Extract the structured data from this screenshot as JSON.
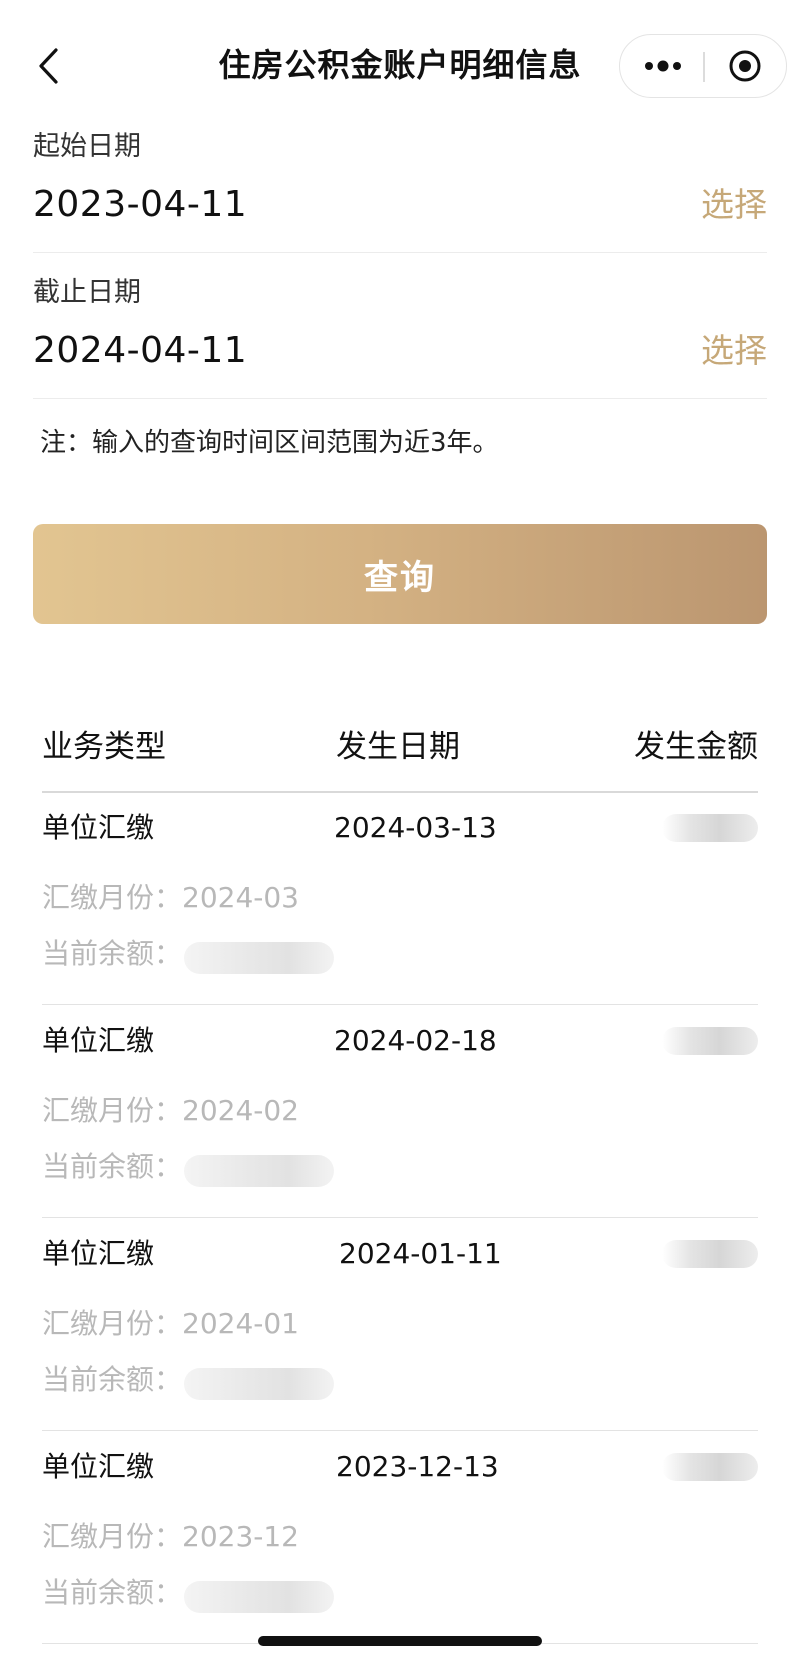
{
  "header": {
    "title": "住房公积金账户明细信息",
    "back_icon": "chevron-left-icon",
    "more_icon": "more-dots-icon",
    "close_icon": "target-circle-icon"
  },
  "start_date": {
    "label": "起始日期",
    "value": "2023-04-11",
    "select_label": "选择"
  },
  "end_date": {
    "label": "截止日期",
    "value": "2024-04-11",
    "select_label": "选择"
  },
  "note": "注：输入的查询时间区间范围为近3年。",
  "query_button": {
    "label": "查询"
  },
  "table": {
    "columns": [
      "业务类型",
      "发生日期",
      "发生金额"
    ],
    "records": [
      {
        "type": "单位汇缴",
        "date": "2024-03-13",
        "month": "汇缴月份：2024-03",
        "balance_label": "当前余额："
      },
      {
        "type": "单位汇缴",
        "date": "2024-02-18",
        "month": "汇缴月份：2024-02",
        "balance_label": "当前余额："
      },
      {
        "type": "单位汇缴",
        "date": "2024-01-11",
        "month": "汇缴月份：2024-01",
        "balance_label": "当前余额："
      },
      {
        "type": "单位汇缴",
        "date": "2023-12-13",
        "month": "汇缴月份：2023-12",
        "balance_label": "当前余额："
      }
    ]
  },
  "colors": {
    "accent": "#c6a878",
    "button_gradient_start": "#e2c591",
    "button_gradient_end": "#bb9670",
    "muted_text": "#b8b8b8"
  }
}
